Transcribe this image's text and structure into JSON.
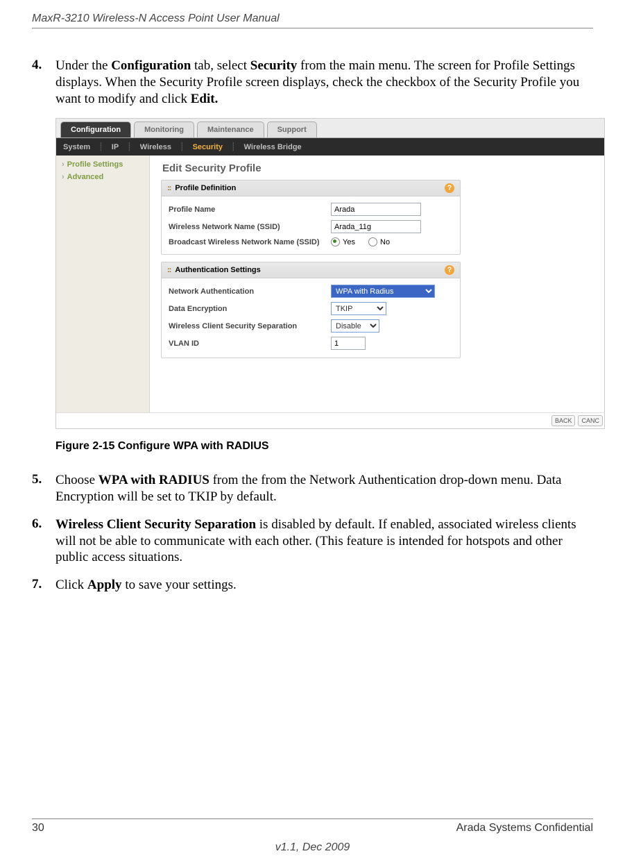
{
  "header": {
    "title": "MaxR-3210 Wireless-N Access Point User Manual"
  },
  "steps": {
    "s4": {
      "num": "4.",
      "pre": "Under the ",
      "b1": "Configuration",
      "mid1": " tab, select ",
      "b2": "Security",
      "mid2": " from the main menu. The screen for Profile Settings displays. When the Security Profile screen displays, check the checkbox of the Security Profile you want to modify and click ",
      "b3": "Edit."
    },
    "s5": {
      "num": "5.",
      "pre": "Choose ",
      "b1": "WPA with RADIUS",
      "post": " from the from the Network Authentication drop-down menu. Data Encryption will be set to TKIP by default."
    },
    "s6": {
      "num": "6.",
      "b1": "Wireless Client Security Separation",
      "post": " is disabled by default. If enabled, associated wireless clients will not be able to communicate with each other. (This feature is intended for hotspots and other public access situations."
    },
    "s7": {
      "num": "7.",
      "pre": "Click ",
      "b1": "Apply",
      "post": " to save your settings."
    }
  },
  "figure": {
    "caption": "Figure 2-15  Configure WPA with RADIUS"
  },
  "screenshot": {
    "tabs": [
      "Configuration",
      "Monitoring",
      "Maintenance",
      "Support"
    ],
    "subnav": [
      "System",
      "IP",
      "Wireless",
      "Security",
      "Wireless Bridge"
    ],
    "sidemenu": [
      "Profile Settings",
      "Advanced"
    ],
    "title": "Edit Security Profile",
    "panel1": {
      "title": "Profile Definition",
      "help": "?",
      "rows": {
        "profile_name_lbl": "Profile Name",
        "profile_name_val": "Arada",
        "ssid_lbl": "Wireless Network Name (SSID)",
        "ssid_val": "Arada_11g",
        "bcast_lbl": "Broadcast Wireless Network Name (SSID)",
        "yes": "Yes",
        "no": "No"
      }
    },
    "panel2": {
      "title": "Authentication Settings",
      "help": "?",
      "rows": {
        "netauth_lbl": "Network Authentication",
        "netauth_val": "WPA with Radius",
        "dataenc_lbl": "Data Encryption",
        "dataenc_val": "TKIP",
        "wcss_lbl": "Wireless Client Security Separation",
        "wcss_val": "Disable",
        "vlan_lbl": "VLAN ID",
        "vlan_val": "1"
      }
    },
    "bottom": {
      "back": "BACK",
      "cancel": "CANC"
    }
  },
  "footer": {
    "page": "30",
    "conf": "Arada Systems Confidential",
    "ver": "v1.1, Dec 2009"
  }
}
